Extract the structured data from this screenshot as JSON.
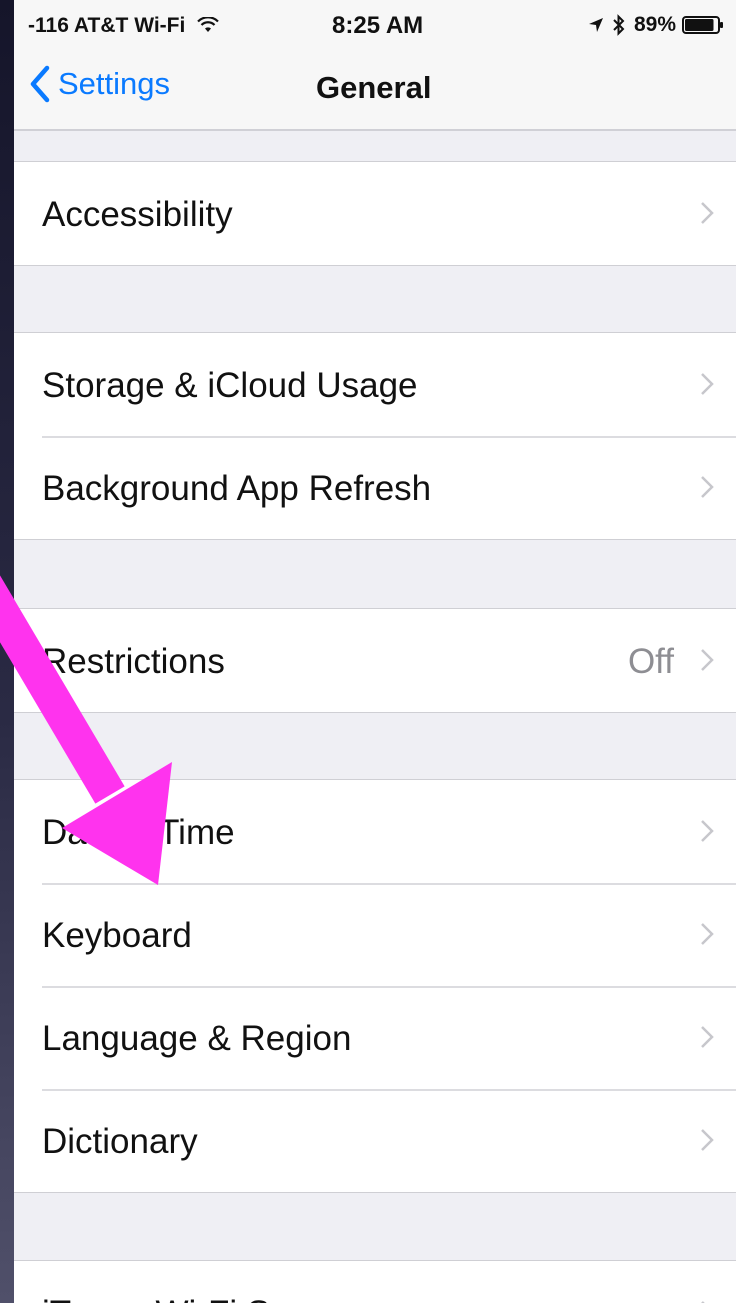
{
  "status_bar": {
    "carrier": "-116 AT&T Wi-Fi",
    "wifi_icon": "wifi-icon",
    "time": "8:25 AM",
    "location_icon": "location-arrow-icon",
    "bluetooth_icon": "bluetooth-icon",
    "battery_percent": "89%",
    "battery_level": 0.89
  },
  "nav": {
    "back_label": "Settings",
    "title": "General"
  },
  "groups": {
    "g1": [
      {
        "label": "Accessibility",
        "value": ""
      }
    ],
    "g2": [
      {
        "label": "Storage & iCloud Usage",
        "value": ""
      },
      {
        "label": "Background App Refresh",
        "value": ""
      }
    ],
    "g3": [
      {
        "label": "Restrictions",
        "value": "Off"
      }
    ],
    "g4": [
      {
        "label": "Date & Time",
        "value": ""
      },
      {
        "label": "Keyboard",
        "value": ""
      },
      {
        "label": "Language & Region",
        "value": ""
      },
      {
        "label": "Dictionary",
        "value": ""
      }
    ],
    "g5": [
      {
        "label": "iTunes Wi-Fi Sync",
        "value": ""
      }
    ]
  },
  "colors": {
    "accent": "#0a7aff",
    "annotation_arrow": "#ff33ee",
    "grouped_background": "#efeff4"
  },
  "icons": {
    "back": "chevron-left-icon",
    "row": "chevron-right-icon",
    "annotation": "annotation-arrow"
  }
}
